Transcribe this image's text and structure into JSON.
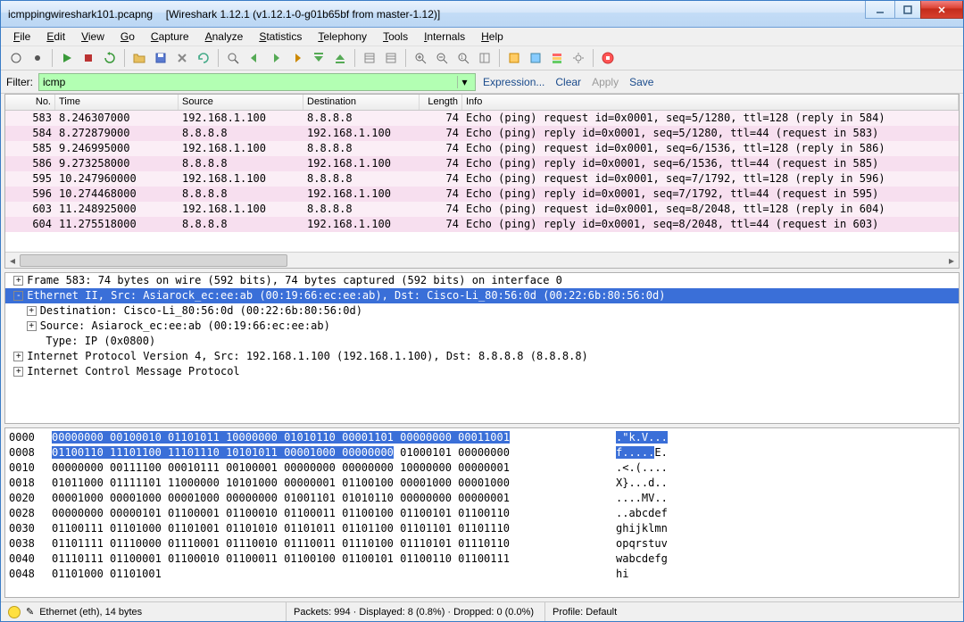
{
  "window": {
    "filename": "icmppingwireshark101.pcapng",
    "app_string": "[Wireshark 1.12.1  (v1.12.1-0-g01b65bf from master-1.12)]"
  },
  "menu": [
    "File",
    "Edit",
    "View",
    "Go",
    "Capture",
    "Analyze",
    "Statistics",
    "Telephony",
    "Tools",
    "Internals",
    "Help"
  ],
  "filter": {
    "label": "Filter:",
    "value": "icmp",
    "expr": "Expression...",
    "clear": "Clear",
    "apply": "Apply",
    "save": "Save"
  },
  "columns": {
    "no": "No.",
    "time": "Time",
    "source": "Source",
    "destination": "Destination",
    "length": "Length",
    "info": "Info"
  },
  "packets": [
    {
      "no": "583",
      "time": "8.246307000",
      "src": "192.168.1.100",
      "dst": "8.8.8.8",
      "len": "74",
      "info": "Echo (ping) request  id=0x0001, seq=5/1280, ttl=128 (reply in 584)",
      "shade": "light"
    },
    {
      "no": "584",
      "time": "8.272879000",
      "src": "8.8.8.8",
      "dst": "192.168.1.100",
      "len": "74",
      "info": "Echo (ping) reply    id=0x0001, seq=5/1280, ttl=44 (request in 583)",
      "shade": "dark"
    },
    {
      "no": "585",
      "time": "9.246995000",
      "src": "192.168.1.100",
      "dst": "8.8.8.8",
      "len": "74",
      "info": "Echo (ping) request  id=0x0001, seq=6/1536, ttl=128 (reply in 586)",
      "shade": "light"
    },
    {
      "no": "586",
      "time": "9.273258000",
      "src": "8.8.8.8",
      "dst": "192.168.1.100",
      "len": "74",
      "info": "Echo (ping) reply    id=0x0001, seq=6/1536, ttl=44 (request in 585)",
      "shade": "dark"
    },
    {
      "no": "595",
      "time": "10.247960000",
      "src": "192.168.1.100",
      "dst": "8.8.8.8",
      "len": "74",
      "info": "Echo (ping) request  id=0x0001, seq=7/1792, ttl=128 (reply in 596)",
      "shade": "light"
    },
    {
      "no": "596",
      "time": "10.274468000",
      "src": "8.8.8.8",
      "dst": "192.168.1.100",
      "len": "74",
      "info": "Echo (ping) reply    id=0x0001, seq=7/1792, ttl=44 (request in 595)",
      "shade": "dark"
    },
    {
      "no": "603",
      "time": "11.248925000",
      "src": "192.168.1.100",
      "dst": "8.8.8.8",
      "len": "74",
      "info": "Echo (ping) request  id=0x0001, seq=8/2048, ttl=128 (reply in 604)",
      "shade": "light"
    },
    {
      "no": "604",
      "time": "11.275518000",
      "src": "8.8.8.8",
      "dst": "192.168.1.100",
      "len": "74",
      "info": "Echo (ping) reply    id=0x0001, seq=8/2048, ttl=44 (request in 603)",
      "shade": "dark"
    }
  ],
  "tree": [
    {
      "indent": 0,
      "exp": "+",
      "text": "Frame 583: 74 bytes on wire (592 bits), 74 bytes captured (592 bits) on interface 0",
      "sel": false
    },
    {
      "indent": 0,
      "exp": "-",
      "text": "Ethernet II, Src: Asiarock_ec:ee:ab (00:19:66:ec:ee:ab), Dst: Cisco-Li_80:56:0d (00:22:6b:80:56:0d)",
      "sel": true
    },
    {
      "indent": 1,
      "exp": "+",
      "text": "Destination: Cisco-Li_80:56:0d (00:22:6b:80:56:0d)",
      "sel": false
    },
    {
      "indent": 1,
      "exp": "+",
      "text": "Source: Asiarock_ec:ee:ab (00:19:66:ec:ee:ab)",
      "sel": false
    },
    {
      "indent": 1,
      "exp": "",
      "text": "Type: IP (0x0800)",
      "sel": false
    },
    {
      "indent": 0,
      "exp": "+",
      "text": "Internet Protocol Version 4, Src: 192.168.1.100 (192.168.1.100), Dst: 8.8.8.8 (8.8.8.8)",
      "sel": false
    },
    {
      "indent": 0,
      "exp": "+",
      "text": "Internet Control Message Protocol",
      "sel": false
    }
  ],
  "hex": [
    {
      "off": "0000",
      "bits": "00000000 00100010 01101011 10000000 01010110 00001101 00000000 00011001",
      "ascii": ".\"k.V...",
      "sel": "full"
    },
    {
      "off": "0008",
      "bits_sel": "01100110 11101100 11101110 10101011 00001000 00000000",
      "bits_rest": " 01000101 00000000",
      "ascii_sel": "f.....",
      "ascii_rest": "E."
    },
    {
      "off": "0010",
      "bits": "00000000 00111100 00010111 00100001 00000000 00000000 10000000 00000001",
      "ascii": ".<.(...."
    },
    {
      "off": "0018",
      "bits": "01011000 01111101 11000000 10101000 00000001 01100100 00001000 00001000",
      "ascii": "X}...d.."
    },
    {
      "off": "0020",
      "bits": "00001000 00001000 00001000 00000000 01001101 01010110 00000000 00000001",
      "ascii": "....MV.."
    },
    {
      "off": "0028",
      "bits": "00000000 00000101 01100001 01100010 01100011 01100100 01100101 01100110",
      "ascii": "..abcdef"
    },
    {
      "off": "0030",
      "bits": "01100111 01101000 01101001 01101010 01101011 01101100 01101101 01101110",
      "ascii": "ghijklmn"
    },
    {
      "off": "0038",
      "bits": "01101111 01110000 01110001 01110010 01110011 01110100 01110101 01110110",
      "ascii": "opqrstuv"
    },
    {
      "off": "0040",
      "bits": "01110111 01100001 01100010 01100011 01100100 01100101 01100110 01100111",
      "ascii": "wabcdefg"
    },
    {
      "off": "0048",
      "bits": "01101000 01101001",
      "ascii": "hi"
    }
  ],
  "status": {
    "left": "Ethernet (eth), 14 bytes",
    "packets": "Packets: 994 · Displayed: 8 (0.8%) · Dropped: 0 (0.0%)",
    "profile": "Profile: Default"
  }
}
